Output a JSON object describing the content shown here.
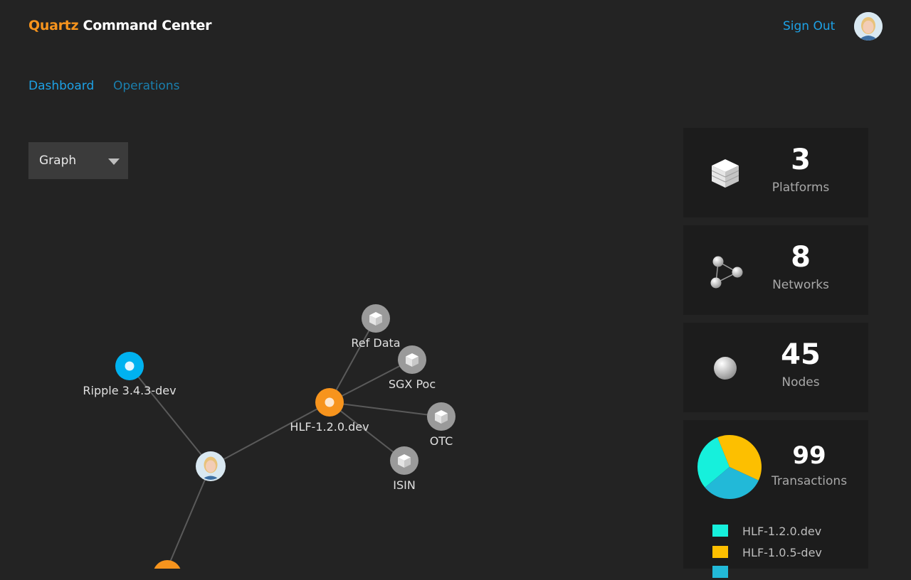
{
  "header": {
    "brand_accent": "Quartz",
    "brand_title": "Command Center",
    "sign_out": "Sign Out",
    "avatar_icon": "user-avatar"
  },
  "nav": {
    "tabs": [
      {
        "label": "Dashboard",
        "active": true
      },
      {
        "label": "Operations",
        "active": false
      }
    ]
  },
  "view_select": {
    "value": "Graph",
    "icon": "caret-down-icon"
  },
  "graph": {
    "labels": {
      "ripple": "Ripple 3.4.3-dev",
      "hlf": "HLF-1.2.0.dev",
      "ref_data": "Ref Data",
      "sgx_poc": "SGX Poc",
      "otc": "OTC",
      "isin": "ISIN"
    }
  },
  "stats": {
    "platforms": {
      "value": "3",
      "label": "Platforms",
      "icon": "cube-icon"
    },
    "networks": {
      "value": "8",
      "label": "Networks",
      "icon": "network-icon"
    },
    "nodes": {
      "value": "45",
      "label": "Nodes",
      "icon": "sphere-icon"
    },
    "transactions": {
      "value": "99",
      "label": "Transactions"
    }
  },
  "chart_data": {
    "type": "pie",
    "title": "",
    "slices": [
      {
        "name": "HLF-1.2.0.dev",
        "value": 30,
        "color": "#16f0dc"
      },
      {
        "name": "HLF-1.0.5-dev",
        "value": 38,
        "color": "#fdbf00"
      },
      {
        "name": "",
        "value": 32,
        "color": "#22b9d8"
      }
    ],
    "legend": "below"
  },
  "colors": {
    "background": "#232323",
    "card": "#1c1c1c",
    "accent_blue": "#1da1e5",
    "accent_orange": "#f7941d"
  }
}
